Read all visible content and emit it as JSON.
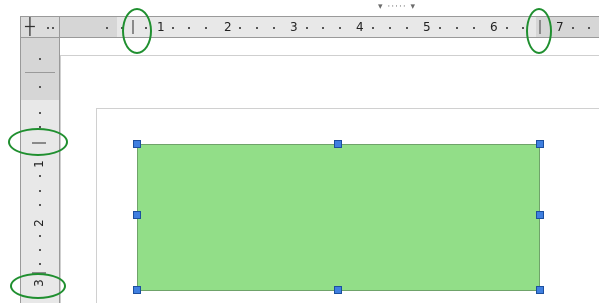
{
  "top_grip": "▾ ····· ▾",
  "corner_icon": "tab-stop-icon",
  "corner_icon_glyph": "┼",
  "horizontal_ruler": {
    "labels": [
      "1",
      "2",
      "3",
      "4",
      "5",
      "6",
      "7"
    ]
  },
  "vertical_ruler": {
    "labels": [
      "1",
      "2",
      "3"
    ]
  },
  "colors": {
    "shape_fill": "#92de88",
    "handle": "#3f7fe0",
    "annotation_oval": "#1f8f2f"
  }
}
